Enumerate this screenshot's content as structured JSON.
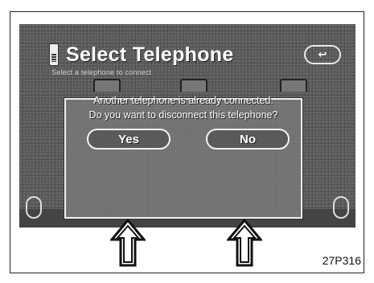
{
  "screen": {
    "title": "Select Telephone",
    "subtitle": "Select a telephone to connect",
    "back_label": "↩"
  },
  "dialog": {
    "line1": "Another telephone is already connected.",
    "line2": "Do you want to disconnect this telephone?",
    "yes_label": "Yes",
    "no_label": "No"
  },
  "figure_code": "27P316"
}
